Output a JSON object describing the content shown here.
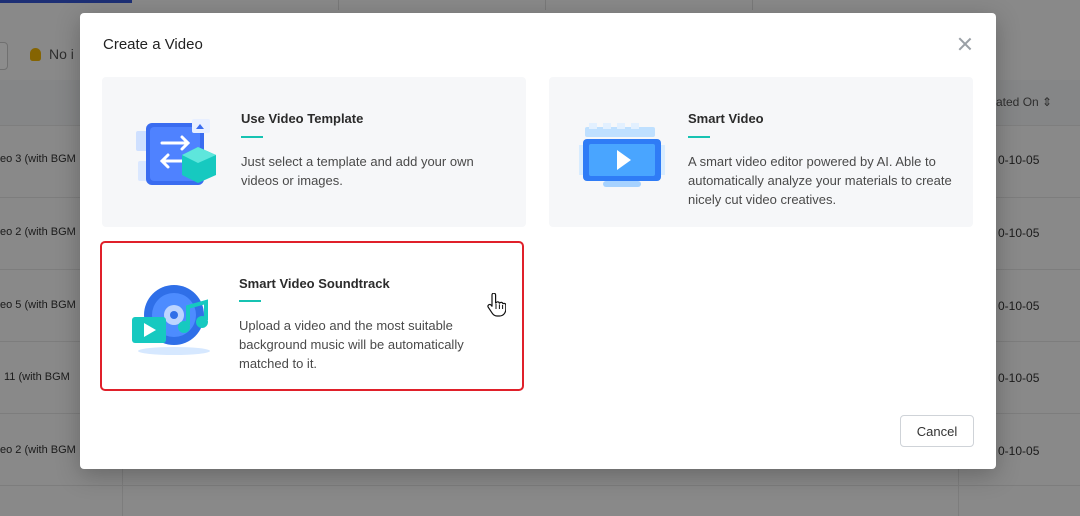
{
  "background": {
    "hint_text": "No i",
    "sort_header": "ated On",
    "rows": [
      {
        "name": "eo 3 (with BGM",
        "date": "0-10-05"
      },
      {
        "name": "eo 2 (with BGM",
        "date": "0-10-05"
      },
      {
        "name": "eo 5 (with BGM",
        "date": "0-10-05"
      },
      {
        "name": "11 (with BGM",
        "date": "0-10-05"
      },
      {
        "name": "eo 2 (with BGM",
        "date": "0-10-05"
      }
    ]
  },
  "modal": {
    "title": "Create a Video",
    "cancel_label": "Cancel",
    "options": [
      {
        "title": "Use Video Template",
        "description": "Just select a template and add your own videos or images.",
        "icon": "video-template-icon"
      },
      {
        "title": "Smart Video",
        "description": "A smart video editor powered by AI. Able to automatically analyze your materials to create nicely cut video creatives.",
        "icon": "smart-video-icon"
      },
      {
        "title": "Smart Video Soundtrack",
        "description": "Upload a video and the most suitable background music will be automatically matched to it.",
        "icon": "soundtrack-icon",
        "selected": true
      }
    ]
  },
  "colors": {
    "accent": "#17c3b2",
    "highlight": "#e0202a",
    "overlay": "rgba(0,0,0,0.45)"
  }
}
